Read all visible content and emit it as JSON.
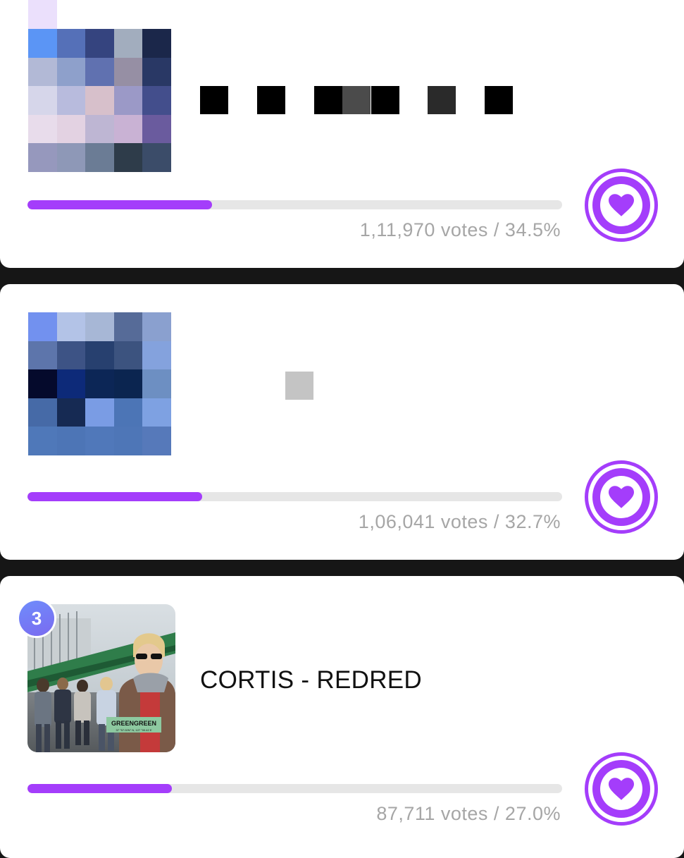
{
  "entries": [
    {
      "rank": "",
      "title": "",
      "title_censored": true,
      "votes_text": "1,11,970 votes / 34.5%",
      "percent": 34.5
    },
    {
      "rank": "",
      "title": "",
      "title_censored": true,
      "votes_text": "1,06,041 votes / 32.7%",
      "percent": 32.7
    },
    {
      "rank": "3",
      "title": "CORTIS - REDRED",
      "album_sign_text": "GREENGREEN",
      "album_sign_subtext": "37 °57.02N° N, 127 °00.42 E",
      "votes_text": "87,711 votes / 27.0%",
      "percent": 27.0
    }
  ],
  "colors": {
    "accent": "#a43dfb",
    "track": "#e6e6e6",
    "stats_text": "#a6a6a6",
    "badge_gradient": [
      "#6f8dfb",
      "#7a6af0"
    ],
    "background": "#161616"
  },
  "icons": {
    "vote_button": "heart-icon"
  }
}
